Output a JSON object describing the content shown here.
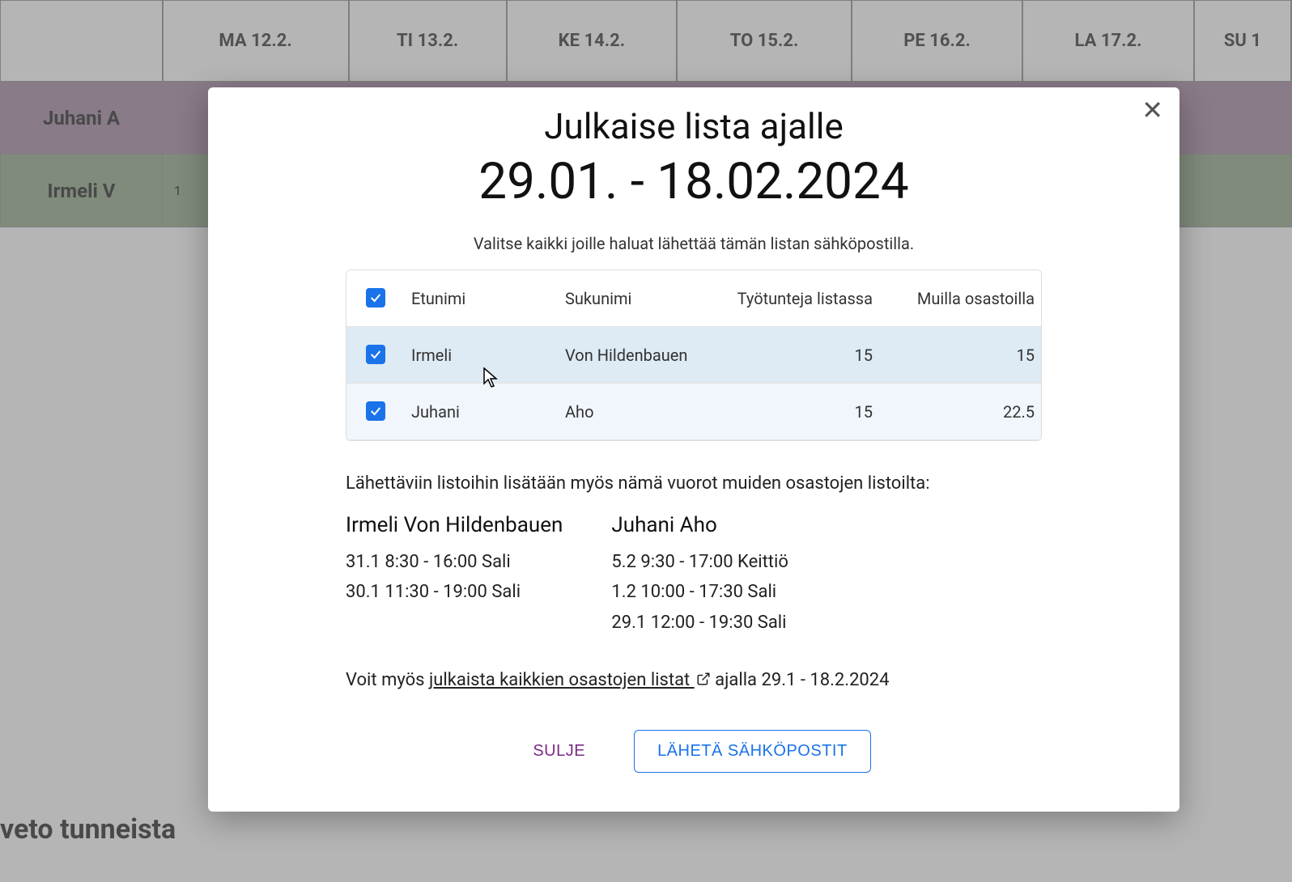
{
  "schedule": {
    "days": [
      "MA 12.2.",
      "TI 13.2.",
      "KE 14.2.",
      "TO 15.2.",
      "PE 16.2.",
      "LA 17.2.",
      "SU 1"
    ],
    "rows": [
      {
        "name": "Juhani A",
        "color": "purple"
      },
      {
        "name": "Irmeli V",
        "color": "green",
        "first_cell": "1"
      }
    ],
    "bottom_caption": "veto tunneista"
  },
  "modal": {
    "title": "Julkaise lista ajalle",
    "date_range": "29.01. - 18.02.2024",
    "instruction": "Valitse kaikki joille haluat lähettää tämän listan sähköpostilla.",
    "table": {
      "headers": {
        "first_name": "Etunimi",
        "last_name": "Sukunimi",
        "hours_in_list": "Työtunteja listassa",
        "other_depts": "Muilla osastoilla"
      },
      "rows": [
        {
          "first_name": "Irmeli",
          "last_name": "Von Hildenbauen",
          "hours_in_list": "15",
          "other_depts": "15"
        },
        {
          "first_name": "Juhani",
          "last_name": "Aho",
          "hours_in_list": "15",
          "other_depts": "22.5"
        }
      ]
    },
    "extra_shifts_intro": "Lähettäviin listoihin lisätään myös nämä vuorot muiden osastojen listoilta:",
    "extra_shifts": [
      {
        "name": "Irmeli Von Hildenbauen",
        "shifts": [
          "31.1 8:30 - 16:00 Sali",
          "30.1 11:30 - 19:00 Sali"
        ]
      },
      {
        "name": "Juhani Aho",
        "shifts": [
          "5.2 9:30 - 17:00 Keittiö",
          "1.2 10:00 - 17:30 Sali",
          "29.1 12:00 - 19:30 Sali"
        ]
      }
    ],
    "footer": {
      "prefix": "Voit myös ",
      "link_text": "julkaista kaikkien osastojen listat ",
      "suffix": " ajalla 29.1 - 18.2.2024"
    },
    "buttons": {
      "close": "SULJE",
      "send": "LÄHETÄ SÄHKÖPOSTIT"
    }
  }
}
